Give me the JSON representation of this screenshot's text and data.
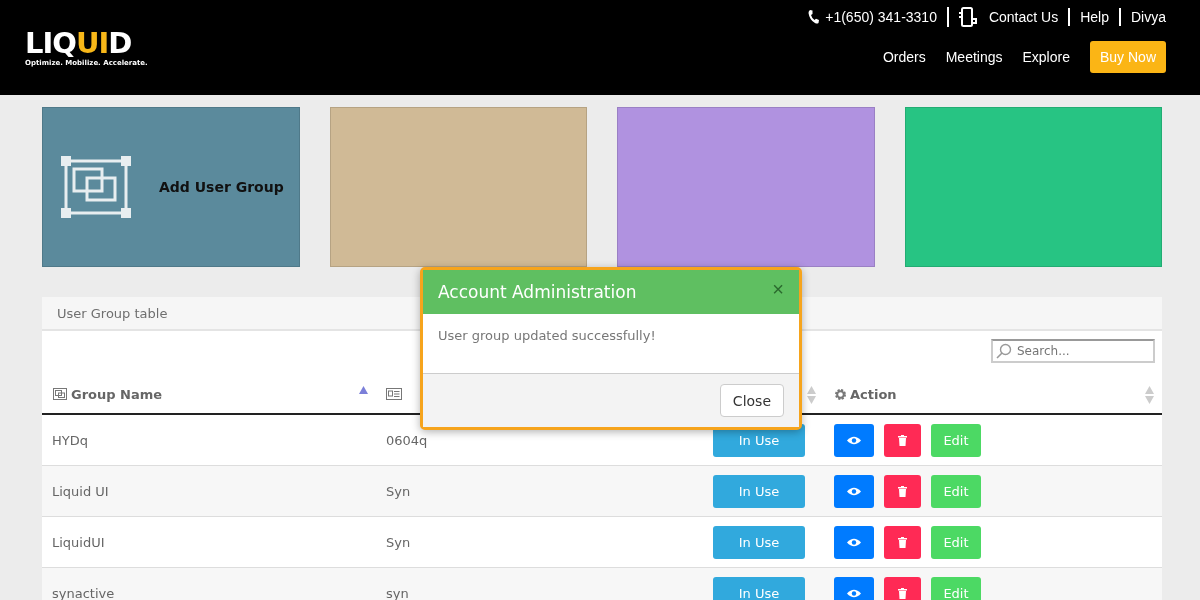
{
  "header": {
    "logo": {
      "text_start": "LIQ",
      "text_accent": "UI",
      "text_end": "D",
      "tagline": "Optimize. Mobilize. Accelerate."
    },
    "top_links": [
      {
        "kind": "phone",
        "label": "+1(650) 341-3310"
      },
      {
        "kind": "contact",
        "label": "Contact Us"
      },
      {
        "kind": "plain",
        "label": "Help"
      },
      {
        "kind": "plain",
        "label": "Divya"
      }
    ],
    "nav": [
      {
        "kind": "link",
        "label": "Orders"
      },
      {
        "kind": "link",
        "label": "Meetings"
      },
      {
        "kind": "link",
        "label": "Explore"
      },
      {
        "kind": "cta",
        "label": "Buy Now"
      }
    ]
  },
  "tiles": [
    {
      "label": "Add User Group",
      "color": "#5b8a9c"
    },
    {
      "color": "#d0ba96"
    },
    {
      "color": "#b092e0"
    },
    {
      "color": "#27c483"
    }
  ],
  "table": {
    "title": "User Group table",
    "search": {
      "placeholder": "Search..."
    },
    "columns": [
      {
        "label": "Group Name",
        "sorted_ascending": true
      },
      {},
      {
        "sorted_ascending": false
      },
      {
        "label": "Action",
        "sorted_ascending": false
      }
    ],
    "rows": [
      {
        "name": "HYDq",
        "column_2": "0604q",
        "status": "In Use",
        "edit": "Edit"
      },
      {
        "name": "Liquid UI",
        "column_2": "Syn",
        "status": "In Use",
        "edit": "Edit"
      },
      {
        "name": "LiquidUI",
        "column_2": "Syn",
        "status": "In Use",
        "edit": "Edit"
      },
      {
        "name": "synactive",
        "column_2": "syn",
        "status": "In Use",
        "edit": "Edit"
      }
    ]
  },
  "dialog": {
    "title": "Account Administration",
    "close_symbol": "×",
    "message": "User group updated successfully!",
    "button": "Close"
  }
}
